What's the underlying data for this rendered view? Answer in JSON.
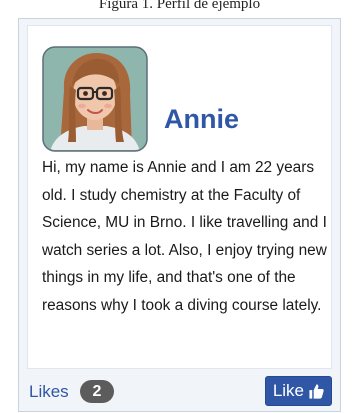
{
  "caption": "Figura 1. Perfil de ejemplo",
  "profile": {
    "name": "Annie",
    "avatar_icon": "woman-with-glasses-avatar",
    "bio": "Hi, my name is Annie and I am 22 years old. I study chemistry at the Faculty of Science, MU in Brno. I like travelling and I watch series a lot. Also, I enjoy trying new things in my life, and that's one of the reasons why I took a diving course lately."
  },
  "footer": {
    "likes_label": "Likes",
    "likes_count": "2",
    "like_button_label": "Like",
    "like_icon": "thumbs-up-icon"
  },
  "colors": {
    "accent": "#2f57a6",
    "badge": "#5c5c5c",
    "card_background": "#f1f4f9"
  }
}
